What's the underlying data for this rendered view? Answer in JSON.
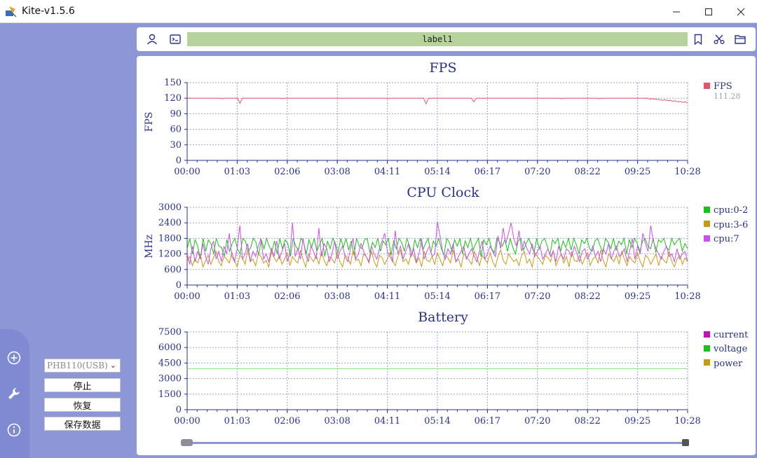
{
  "window": {
    "title": "Kite-v1.5.6",
    "controls": [
      "minimize",
      "maximize",
      "close"
    ]
  },
  "toolbar": {
    "label": "label1",
    "icons_left": [
      "user-icon",
      "terminal-icon"
    ],
    "icons_right": [
      "bookmark-icon",
      "scissors-icon",
      "folder-icon"
    ]
  },
  "sidebar": {
    "icons": [
      "add-circle-icon",
      "wrench-icon",
      "info-icon"
    ],
    "device_select": {
      "value": "PHB110(USB)"
    },
    "buttons": {
      "stop": "停止",
      "resume": "恢复",
      "save": "保存数据"
    }
  },
  "colors": {
    "fps": "#e8546a",
    "cpu_0_2": "#19c219",
    "cpu_3_6": "#c89a12",
    "cpu_7": "#cc4ff0",
    "current": "#c014b8",
    "voltage": "#19c219",
    "power": "#c89a12",
    "voltage_line": "#90e090",
    "title": "#27328f"
  },
  "chart_data": [
    {
      "type": "line",
      "title": "FPS",
      "ylabel": "FPS",
      "xlabel": "",
      "ylim": [
        0,
        150
      ],
      "yticks": [
        0,
        30,
        60,
        90,
        120,
        150
      ],
      "xticks": [
        "00:00",
        "01:03",
        "02:06",
        "03:08",
        "04:11",
        "05:14",
        "06:17",
        "07:20",
        "08:22",
        "09:25",
        "10:28"
      ],
      "grid": true,
      "legend_position": "right",
      "series": [
        {
          "name": "FPS",
          "color": "#e8546a",
          "current_value": "111.28",
          "values": [
            120,
            120,
            120,
            120,
            120,
            120,
            120,
            120,
            120,
            120,
            120,
            120,
            120,
            120,
            119,
            120,
            120,
            120,
            120,
            120,
            120,
            110,
            120,
            120,
            120,
            120,
            120,
            120,
            120,
            120,
            120,
            120,
            120,
            120,
            120,
            120,
            120,
            120,
            119,
            120,
            120,
            120,
            120,
            120,
            120,
            120,
            120,
            120,
            120,
            120,
            120,
            120,
            120,
            120,
            120,
            120,
            120,
            120,
            120,
            120,
            120,
            120,
            120,
            120,
            120,
            120,
            120,
            120,
            120,
            120,
            120,
            120,
            120,
            120,
            120,
            120,
            120,
            120,
            120,
            120,
            119,
            120,
            120,
            120,
            120,
            120,
            120,
            120,
            120,
            120,
            120,
            120,
            120,
            120,
            120,
            109,
            120,
            120,
            120,
            120,
            120,
            120,
            120,
            120,
            120,
            120,
            120,
            120,
            120,
            120,
            120,
            120,
            120,
            120,
            113,
            120,
            120,
            120,
            120,
            120,
            120,
            120,
            120,
            120,
            120,
            120,
            120,
            120,
            120,
            120,
            120,
            120,
            120,
            120,
            120,
            120,
            120,
            120,
            120,
            120,
            120,
            120,
            120,
            120,
            120,
            120,
            120,
            120,
            120,
            119,
            120,
            120,
            120,
            120,
            120,
            120,
            120,
            120,
            120,
            120,
            120,
            120,
            120,
            120,
            119,
            120,
            120,
            120,
            120,
            120,
            120,
            120,
            120,
            120,
            120,
            120,
            120,
            120,
            120,
            120,
            120,
            120,
            120,
            120,
            118,
            119,
            118,
            118,
            117,
            116,
            117,
            115,
            116,
            114,
            115,
            113,
            114,
            112,
            113,
            111
          ]
        }
      ]
    },
    {
      "type": "line",
      "title": "CPU Clock",
      "ylabel": "MHz",
      "xlabel": "",
      "ylim": [
        0,
        3000
      ],
      "yticks": [
        0,
        600,
        1200,
        1800,
        2400,
        3000
      ],
      "xticks": [
        "00:00",
        "01:03",
        "02:06",
        "03:08",
        "04:11",
        "05:14",
        "06:17",
        "07:20",
        "08:22",
        "09:25",
        "10:28"
      ],
      "grid": true,
      "legend_position": "right",
      "series": [
        {
          "name": "cpu:0-2",
          "color": "#19c219",
          "values": [
            1400,
            1800,
            1200,
            1750,
            1500,
            1000,
            1800,
            1300,
            1750,
            1600,
            1200,
            1800,
            1500,
            1450,
            1100,
            1750,
            1300,
            1600,
            1800,
            1400,
            1200,
            1800,
            1700,
            1300,
            1450,
            1800,
            1650,
            1150,
            1750,
            1400,
            1800,
            1500,
            1300,
            1700,
            1200,
            1800,
            1400,
            1750,
            1600,
            1100,
            1800,
            1500,
            1350,
            1800,
            1650,
            1200,
            1750,
            1450,
            1800,
            1300,
            1550,
            1800,
            1100,
            1700,
            1400,
            1800,
            1600,
            1250,
            1800,
            1450,
            1800,
            1350,
            1700,
            1150,
            1800,
            1500,
            1400,
            1750,
            1800,
            1250,
            1650,
            1450,
            1800,
            1300,
            1700,
            1550,
            1800,
            1150,
            1700,
            1400,
            1800,
            1650,
            1300,
            1800,
            1500,
            1200,
            1750,
            1450,
            1800,
            1350,
            1600,
            1800,
            1250,
            1700,
            1500,
            1800,
            1400,
            1150,
            1800,
            1650,
            1300,
            1750,
            1500,
            1800,
            1200,
            1700,
            1450,
            1800,
            1350,
            1600,
            1800,
            1100,
            1750,
            1550,
            1800,
            1400,
            1250,
            1800,
            1650,
            1500,
            1750,
            1300,
            1800,
            1450,
            1200,
            1700,
            1800,
            1350,
            1600,
            1800,
            1550,
            1250,
            1800,
            1400,
            1700,
            1800,
            1500,
            1150,
            1750,
            1600,
            1800,
            1300,
            1700,
            1450,
            1800,
            1350,
            1800,
            1550,
            1200,
            1750,
            1600,
            1800,
            1400,
            1300,
            1700,
            1800,
            1500,
            1250,
            1800,
            1650,
            1400,
            1800,
            1350,
            1700,
            1550,
            1800,
            1200,
            1750,
            1450,
            1800,
            1600,
            1300,
            1700,
            1800,
            1500,
            1400,
            1800,
            1250,
            1750,
            1650,
            1800,
            1450,
            1350,
            1800,
            1550,
            1700,
            1800,
            1300,
            1600,
            1400
          ]
        },
        {
          "name": "cpu:3-6",
          "color": "#c89a12",
          "values": [
            900,
            1100,
            750,
            1000,
            850,
            1200,
            700,
            950,
            1150,
            800,
            1050,
            1300,
            900,
            750,
            1100,
            1000,
            850,
            1250,
            950,
            700,
            1150,
            1050,
            800,
            1350,
            900,
            1000,
            750,
            1200,
            1100,
            850,
            950,
            700,
            1300,
            1050,
            900,
            1150,
            800,
            1000,
            1250,
            750,
            1100,
            950,
            850,
            1350,
            1000,
            700,
            1200,
            1050,
            900,
            1150,
            800,
            1300,
            950,
            750,
            1100,
            1000,
            850,
            1250,
            900,
            700,
            1150,
            1050,
            800,
            1350,
            950,
            1000,
            750,
            1200,
            1100,
            850,
            1300,
            900,
            700,
            1150,
            1050,
            800,
            1000,
            1250,
            950,
            750,
            1100,
            1350,
            900,
            1000,
            800,
            1200,
            1150,
            850,
            1050,
            700,
            1300,
            950,
            900,
            1100,
            800,
            1250,
            1000,
            750,
            1150,
            1050,
            850,
            1350,
            900,
            1000,
            700,
            1200,
            1100,
            950,
            800,
            1300,
            1050,
            750,
            1150,
            1000,
            850,
            1250,
            900,
            700,
            1100,
            1350,
            950,
            800,
            1200,
            1050,
            900,
            1000,
            750,
            1150,
            1300,
            850,
            1000,
            700,
            1250,
            1100,
            950,
            800,
            1150,
            1050,
            900,
            1350,
            750,
            1000,
            1200,
            850,
            1100,
            700,
            1300,
            950,
            900,
            1150,
            800,
            1050,
            1250,
            750,
            1000,
            1100,
            850,
            1350,
            950,
            700,
            1200,
            1050,
            900,
            1150,
            800,
            1300,
            1000,
            750,
            1100,
            950,
            850,
            1250,
            900,
            700,
            1150,
            1050,
            800,
            1000,
            1200,
            750,
            1100,
            950,
            850,
            1300,
            900,
            700,
            1000,
            1150,
            800,
            1050,
            900
          ]
        },
        {
          "name": "cpu:7",
          "color": "#cc4ff0",
          "values": [
            1200,
            800,
            1500,
            900,
            1300,
            1000,
            1600,
            1100,
            800,
            1400,
            1700,
            1000,
            1300,
            900,
            1500,
            1200,
            2000,
            1100,
            900,
            1400,
            2300,
            1000,
            1200,
            1600,
            900,
            1300,
            1100,
            1500,
            1800,
            1000,
            1200,
            900,
            1400,
            1100,
            1700,
            1000,
            1300,
            1600,
            900,
            1200,
            2400,
            1100,
            1400,
            1000,
            1800,
            1200,
            900,
            1500,
            1300,
            1000,
            2200,
            1100,
            1600,
            1400,
            900,
            1200,
            1700,
            1000,
            1300,
            1500,
            1100,
            900,
            1400,
            1800,
            1000,
            1200,
            1600,
            1300,
            1100,
            900,
            1500,
            1200,
            1000,
            1400,
            1700,
            2000,
            1300,
            1100,
            900,
            2100,
            1200,
            1500,
            1000,
            1300,
            1600,
            1100,
            1400,
            900,
            1200,
            1800,
            1000,
            1300,
            1500,
            1100,
            1200,
            2450,
            1900,
            1300,
            1000,
            1400,
            1200,
            1600,
            900,
            1100,
            1300,
            1500,
            1000,
            1200,
            1400,
            1100,
            900,
            1300,
            1700,
            1000,
            1200,
            1500,
            1300,
            1100,
            1900,
            1400,
            2200,
            1600,
            2000,
            2400,
            1800,
            1500,
            2100,
            1300,
            1700,
            1400,
            1200,
            1600,
            1100,
            1300,
            1500,
            1000,
            1200,
            1400,
            1100,
            1300,
            900,
            1500,
            1200,
            1000,
            1400,
            1300,
            1100,
            1500,
            1200,
            900,
            1300,
            1400,
            1000,
            1200,
            1500,
            1100,
            1300,
            900,
            1400,
            1200,
            1600,
            1000,
            1300,
            1500,
            1100,
            1200,
            1400,
            900,
            1300,
            1800,
            1000,
            1500,
            1200,
            2000,
            1600,
            1300,
            2300,
            1700,
            1400,
            1200,
            1000,
            1300,
            1500,
            1100,
            1200,
            900,
            1400,
            1000,
            1200,
            1300,
            900
          ]
        }
      ]
    },
    {
      "type": "line",
      "title": "Battery",
      "ylabel": "",
      "xlabel": "",
      "ylim": [
        0,
        7500
      ],
      "yticks": [
        0,
        1500,
        3000,
        4500,
        6000,
        7500
      ],
      "xticks": [
        "00:00",
        "01:03",
        "02:06",
        "03:08",
        "04:11",
        "05:14",
        "06:17",
        "07:20",
        "08:22",
        "09:25",
        "10:28"
      ],
      "grid": true,
      "legend_position": "right",
      "legend": [
        "current",
        "voltage",
        "power"
      ],
      "series": [
        {
          "name": "voltage",
          "color": "#90e090",
          "values": [
            3950,
            3950
          ]
        }
      ]
    }
  ]
}
